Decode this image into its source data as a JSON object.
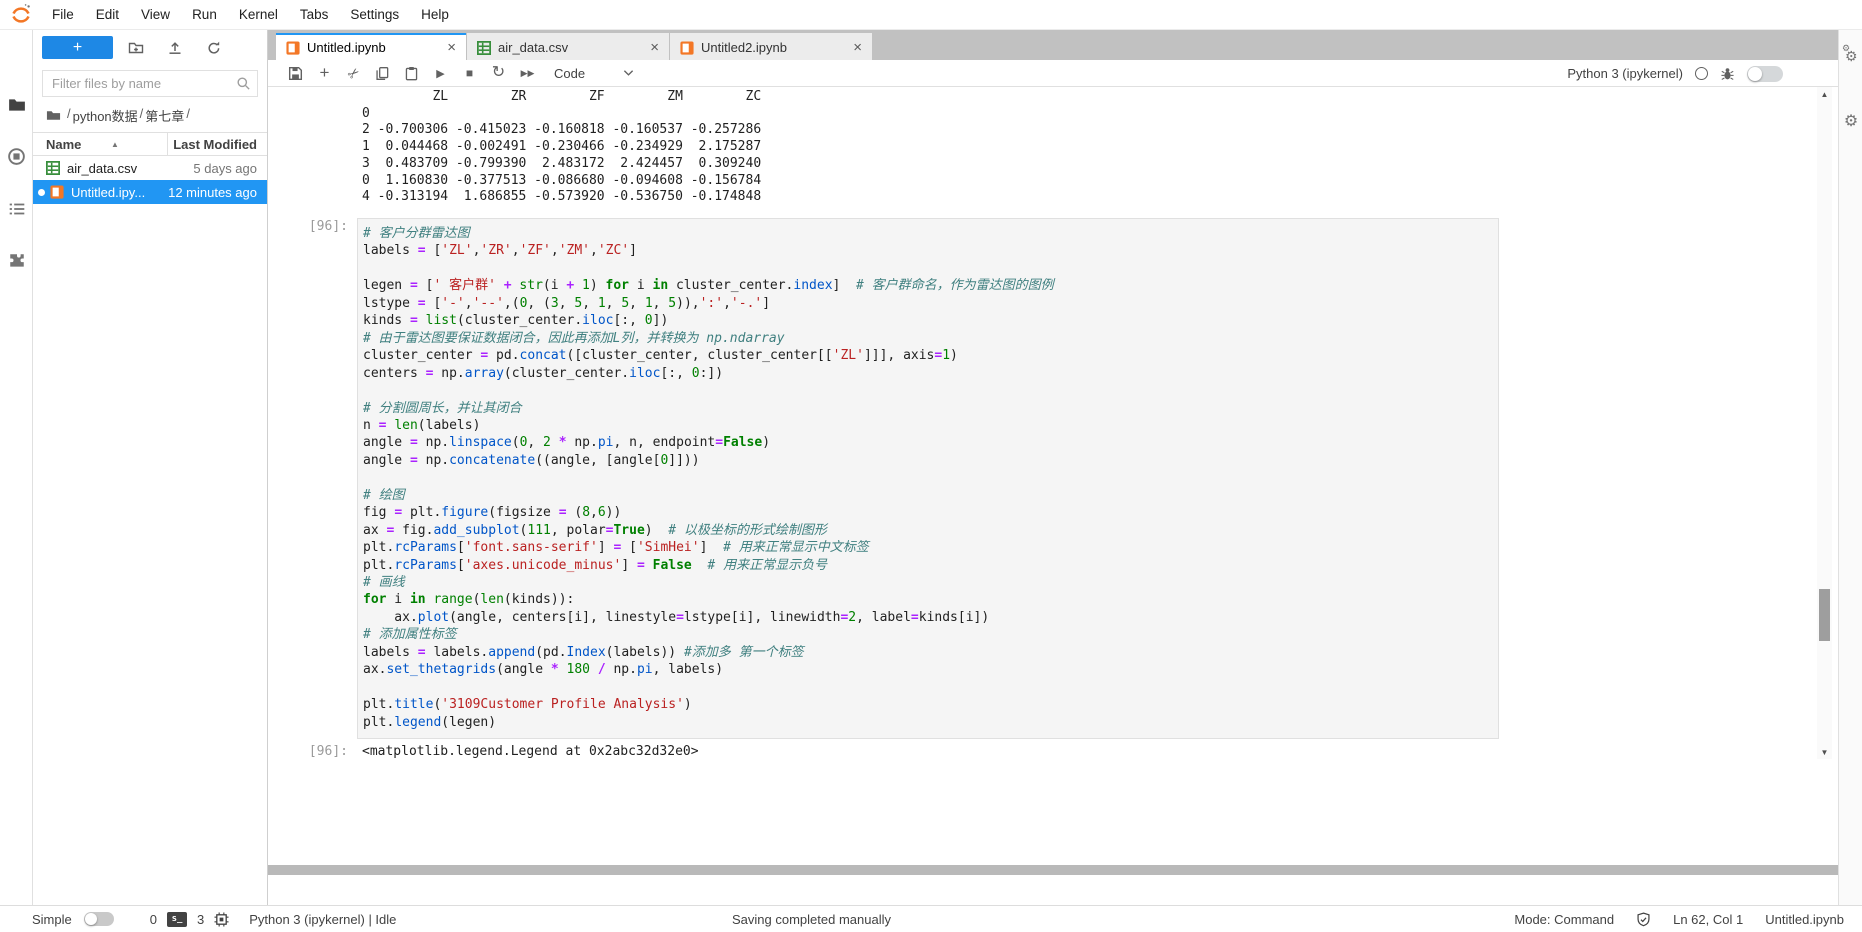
{
  "menu_bar": {
    "items": [
      "File",
      "Edit",
      "View",
      "Run",
      "Kernel",
      "Tabs",
      "Settings",
      "Help"
    ]
  },
  "left_activity_bar": {
    "icons": [
      "file-browser",
      "running-sessions",
      "table-of-contents",
      "extension-manager"
    ]
  },
  "file_browser": {
    "new_button_label": "+",
    "action_icons": [
      "new-folder",
      "upload",
      "refresh"
    ],
    "filter_placeholder": "Filter files by name",
    "breadcrumb": {
      "segments": [
        "python数据",
        "第七章"
      ],
      "separator": "/"
    },
    "columns": {
      "name": "Name",
      "modified": "Last Modified"
    },
    "files": [
      {
        "name": "air_data.csv",
        "modified": "5 days ago",
        "icon": "csv",
        "selected": false,
        "running": false
      },
      {
        "name": "Untitled.ipy...",
        "modified": "12 minutes ago",
        "icon": "notebook",
        "selected": true,
        "running": true
      }
    ]
  },
  "dock_tabs": [
    {
      "label": "Untitled.ipynb",
      "icon": "notebook",
      "active": true
    },
    {
      "label": "air_data.csv",
      "icon": "csv",
      "active": false
    },
    {
      "label": "Untitled2.ipynb",
      "icon": "notebook",
      "active": false
    }
  ],
  "notebook_toolbar": {
    "icons": [
      "save",
      "add-cell",
      "cut",
      "copy",
      "paste",
      "run",
      "stop",
      "restart",
      "fast-forward"
    ],
    "cell_type": "Code",
    "kernel_name": "Python 3 (ipykernel)"
  },
  "notebook": {
    "scrollback_lines": [
      "         ZL        ZR        ZF        ZM        ZC",
      "0                                                  ",
      "2 -0.700306 -0.415023 -0.160818 -0.160537 -0.257286",
      "1  0.044468 -0.002491 -0.230466 -0.234929  2.175287",
      "3  0.483709 -0.799390  2.483172  2.424457  0.309240",
      "0  1.160830 -0.377513 -0.086680 -0.094608 -0.156784",
      "4 -0.313194  1.686855 -0.573920 -0.536750 -0.174848"
    ],
    "cell": {
      "prompt": "[96]:",
      "code_lines": [
        [
          [
            "c",
            "# 客户分群雷达图"
          ]
        ],
        [
          [
            "t",
            "labels "
          ],
          [
            "o",
            "="
          ],
          [
            "t",
            " ["
          ],
          [
            "s",
            "'ZL'"
          ],
          [
            "t",
            ","
          ],
          [
            "s",
            "'ZR'"
          ],
          [
            "t",
            ","
          ],
          [
            "s",
            "'ZF'"
          ],
          [
            "t",
            ","
          ],
          [
            "s",
            "'ZM'"
          ],
          [
            "t",
            ","
          ],
          [
            "s",
            "'ZC'"
          ],
          [
            "t",
            "]"
          ]
        ],
        [],
        [
          [
            "t",
            "legen "
          ],
          [
            "o",
            "="
          ],
          [
            "t",
            " ["
          ],
          [
            "s",
            "' 客户群'"
          ],
          [
            "t",
            " "
          ],
          [
            "o",
            "+"
          ],
          [
            "t",
            " "
          ],
          [
            "b",
            "str"
          ],
          [
            "t",
            "(i "
          ],
          [
            "o",
            "+"
          ],
          [
            "t",
            " "
          ],
          [
            "n",
            "1"
          ],
          [
            "t",
            ") "
          ],
          [
            "k",
            "for"
          ],
          [
            "t",
            " i "
          ],
          [
            "k",
            "in"
          ],
          [
            "t",
            " cluster_center."
          ],
          [
            "p",
            "index"
          ],
          [
            "t",
            "]  "
          ],
          [
            "c",
            "# 客户群命名，作为雷达图的图例"
          ]
        ],
        [
          [
            "t",
            "lstype "
          ],
          [
            "o",
            "="
          ],
          [
            "t",
            " ["
          ],
          [
            "s",
            "'-'"
          ],
          [
            "t",
            ","
          ],
          [
            "s",
            "'--'"
          ],
          [
            "t",
            ",("
          ],
          [
            "n",
            "0"
          ],
          [
            "t",
            ", ("
          ],
          [
            "n",
            "3"
          ],
          [
            "t",
            ", "
          ],
          [
            "n",
            "5"
          ],
          [
            "t",
            ", "
          ],
          [
            "n",
            "1"
          ],
          [
            "t",
            ", "
          ],
          [
            "n",
            "5"
          ],
          [
            "t",
            ", "
          ],
          [
            "n",
            "1"
          ],
          [
            "t",
            ", "
          ],
          [
            "n",
            "5"
          ],
          [
            "t",
            ")),"
          ],
          [
            "s",
            "':'"
          ],
          [
            "t",
            ","
          ],
          [
            "s",
            "'-.'"
          ],
          [
            "t",
            "]"
          ]
        ],
        [
          [
            "t",
            "kinds "
          ],
          [
            "o",
            "="
          ],
          [
            "t",
            " "
          ],
          [
            "b",
            "list"
          ],
          [
            "t",
            "(cluster_center."
          ],
          [
            "p",
            "iloc"
          ],
          [
            "t",
            "[:, "
          ],
          [
            "n",
            "0"
          ],
          [
            "t",
            "])"
          ]
        ],
        [
          [
            "c",
            "# 由于雷达图要保证数据闭合，因此再添加L列，并转换为 np.ndarray"
          ]
        ],
        [
          [
            "t",
            "cluster_center "
          ],
          [
            "o",
            "="
          ],
          [
            "t",
            " pd."
          ],
          [
            "p",
            "concat"
          ],
          [
            "t",
            "([cluster_center, cluster_center[["
          ],
          [
            "s",
            "'ZL'"
          ],
          [
            "t",
            "]]], axis"
          ],
          [
            "o",
            "="
          ],
          [
            "n",
            "1"
          ],
          [
            "t",
            ")"
          ]
        ],
        [
          [
            "t",
            "centers "
          ],
          [
            "o",
            "="
          ],
          [
            "t",
            " np."
          ],
          [
            "p",
            "array"
          ],
          [
            "t",
            "(cluster_center."
          ],
          [
            "p",
            "iloc"
          ],
          [
            "t",
            "[:, "
          ],
          [
            "n",
            "0"
          ],
          [
            "t",
            ":])"
          ]
        ],
        [],
        [
          [
            "c",
            "# 分割圆周长，并让其闭合"
          ]
        ],
        [
          [
            "t",
            "n "
          ],
          [
            "o",
            "="
          ],
          [
            "t",
            " "
          ],
          [
            "b",
            "len"
          ],
          [
            "t",
            "(labels)"
          ]
        ],
        [
          [
            "t",
            "angle "
          ],
          [
            "o",
            "="
          ],
          [
            "t",
            " np."
          ],
          [
            "p",
            "linspace"
          ],
          [
            "t",
            "("
          ],
          [
            "n",
            "0"
          ],
          [
            "t",
            ", "
          ],
          [
            "n",
            "2"
          ],
          [
            "t",
            " "
          ],
          [
            "o",
            "*"
          ],
          [
            "t",
            " np."
          ],
          [
            "p",
            "pi"
          ],
          [
            "t",
            ", n, endpoint"
          ],
          [
            "o",
            "="
          ],
          [
            "k",
            "False"
          ],
          [
            "t",
            ")"
          ]
        ],
        [
          [
            "t",
            "angle "
          ],
          [
            "o",
            "="
          ],
          [
            "t",
            " np."
          ],
          [
            "p",
            "concatenate"
          ],
          [
            "t",
            "((angle, [angle["
          ],
          [
            "n",
            "0"
          ],
          [
            "t",
            "]]))"
          ]
        ],
        [],
        [
          [
            "c",
            "# 绘图"
          ]
        ],
        [
          [
            "t",
            "fig "
          ],
          [
            "o",
            "="
          ],
          [
            "t",
            " plt."
          ],
          [
            "p",
            "figure"
          ],
          [
            "t",
            "(figsize "
          ],
          [
            "o",
            "="
          ],
          [
            "t",
            " ("
          ],
          [
            "n",
            "8"
          ],
          [
            "t",
            ","
          ],
          [
            "n",
            "6"
          ],
          [
            "t",
            "))"
          ]
        ],
        [
          [
            "t",
            "ax "
          ],
          [
            "o",
            "="
          ],
          [
            "t",
            " fig."
          ],
          [
            "p",
            "add_subplot"
          ],
          [
            "t",
            "("
          ],
          [
            "n",
            "111"
          ],
          [
            "t",
            ", polar"
          ],
          [
            "o",
            "="
          ],
          [
            "k",
            "True"
          ],
          [
            "t",
            ")  "
          ],
          [
            "c",
            "# 以极坐标的形式绘制图形"
          ]
        ],
        [
          [
            "t",
            "plt."
          ],
          [
            "p",
            "rcParams"
          ],
          [
            "t",
            "["
          ],
          [
            "s",
            "'font.sans-serif'"
          ],
          [
            "t",
            "] "
          ],
          [
            "o",
            "="
          ],
          [
            "t",
            " ["
          ],
          [
            "s",
            "'SimHei'"
          ],
          [
            "t",
            "]  "
          ],
          [
            "c",
            "# 用来正常显示中文标签"
          ]
        ],
        [
          [
            "t",
            "plt."
          ],
          [
            "p",
            "rcParams"
          ],
          [
            "t",
            "["
          ],
          [
            "s",
            "'axes.unicode_minus'"
          ],
          [
            "t",
            "] "
          ],
          [
            "o",
            "="
          ],
          [
            "t",
            " "
          ],
          [
            "k",
            "False"
          ],
          [
            "t",
            "  "
          ],
          [
            "c",
            "# 用来正常显示负号"
          ]
        ],
        [
          [
            "c",
            "# 画线"
          ]
        ],
        [
          [
            "k",
            "for"
          ],
          [
            "t",
            " i "
          ],
          [
            "k",
            "in"
          ],
          [
            "t",
            " "
          ],
          [
            "b",
            "range"
          ],
          [
            "t",
            "("
          ],
          [
            "b",
            "len"
          ],
          [
            "t",
            "(kinds)):"
          ]
        ],
        [
          [
            "t",
            "    ax."
          ],
          [
            "p",
            "plot"
          ],
          [
            "t",
            "(angle, centers[i], linestyle"
          ],
          [
            "o",
            "="
          ],
          [
            "t",
            "lstype[i], linewidth"
          ],
          [
            "o",
            "="
          ],
          [
            "n",
            "2"
          ],
          [
            "t",
            ", label"
          ],
          [
            "o",
            "="
          ],
          [
            "t",
            "kinds[i])"
          ]
        ],
        [
          [
            "c",
            "# 添加属性标签"
          ]
        ],
        [
          [
            "t",
            "labels "
          ],
          [
            "o",
            "="
          ],
          [
            "t",
            " labels."
          ],
          [
            "p",
            "append"
          ],
          [
            "t",
            "(pd."
          ],
          [
            "p",
            "Index"
          ],
          [
            "t",
            "(labels)) "
          ],
          [
            "c",
            "#添加多 第一个标签"
          ]
        ],
        [
          [
            "t",
            "ax."
          ],
          [
            "p",
            "set_thetagrids"
          ],
          [
            "t",
            "(angle "
          ],
          [
            "o",
            "*"
          ],
          [
            "t",
            " "
          ],
          [
            "n",
            "180"
          ],
          [
            "t",
            " "
          ],
          [
            "o",
            "/"
          ],
          [
            "t",
            " np."
          ],
          [
            "p",
            "pi"
          ],
          [
            "t",
            ", labels)"
          ]
        ],
        [],
        [
          [
            "t",
            "plt."
          ],
          [
            "p",
            "title"
          ],
          [
            "t",
            "("
          ],
          [
            "s",
            "'3109Customer Profile Analysis'"
          ],
          [
            "t",
            ")"
          ]
        ],
        [
          [
            "t",
            "plt."
          ],
          [
            "p",
            "legend"
          ],
          [
            "t",
            "(legen)"
          ]
        ]
      ]
    },
    "output": {
      "prompt": "[96]:",
      "text": "<matplotlib.legend.Legend at 0x2abc32d32e0>"
    }
  },
  "status_bar": {
    "mode_toggle_label": "Simple",
    "terminals_count": "0",
    "kernels_count": "3",
    "kernel_status": "Python 3 (ipykernel) | Idle",
    "save_status": "Saving completed manually",
    "mode": "Mode: Command",
    "cursor_position": "Ln 62, Col 1",
    "active_file": "Untitled.ipynb"
  },
  "colors": {
    "accent_blue": "#2196f3",
    "brand_orange": "#F37726",
    "csv_green": "#388e3c",
    "selection_blue": "#2196f3",
    "tabbar_gray": "#c1c1c1"
  },
  "syntax_colors": {
    "text": "#212121",
    "comment": "#408080",
    "string": "#BA2121",
    "keyword": "#008000",
    "builtin": "#008000",
    "number": "#008000",
    "operator": "#AA22FF",
    "property": "#0055c8"
  }
}
